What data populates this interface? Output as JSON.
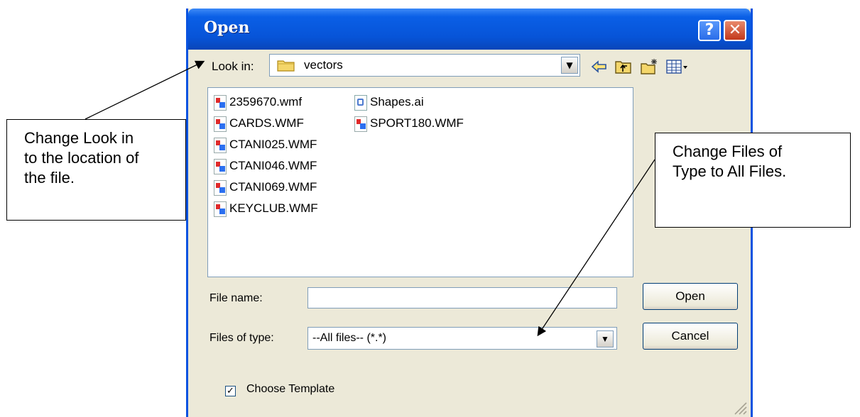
{
  "window": {
    "title": "Open",
    "help_glyph": "?",
    "close_glyph": "✕"
  },
  "lookin": {
    "label": "Look in:",
    "value": "vectors",
    "icon": "folder-icon"
  },
  "toolbar": {
    "icons": [
      "back-arrow-icon",
      "up-folder-icon",
      "new-folder-icon",
      "view-menu-icon"
    ]
  },
  "files": {
    "column1": [
      "2359670.wmf",
      "CARDS.WMF",
      "CTANI025.WMF",
      "CTANI046.WMF",
      "CTANI069.WMF",
      "KEYCLUB.WMF"
    ],
    "column2": [
      "Shapes.ai",
      "SPORT180.WMF"
    ]
  },
  "filename": {
    "label": "File name:",
    "value": ""
  },
  "filetype": {
    "label": "Files of type:",
    "value": "--All files-- (*.*)"
  },
  "buttons": {
    "open": "Open",
    "cancel": "Cancel"
  },
  "template": {
    "label": "Choose Template",
    "checked": true,
    "mark": "✓"
  },
  "callouts": {
    "left": [
      "Change Look in",
      "to the location of",
      "the file."
    ],
    "right": [
      "Change Files of",
      "Type to All Files."
    ]
  },
  "colors": {
    "title_bar": "#0754d8",
    "dialog_bg": "#ece9d8",
    "close_red": "#c2381b"
  }
}
